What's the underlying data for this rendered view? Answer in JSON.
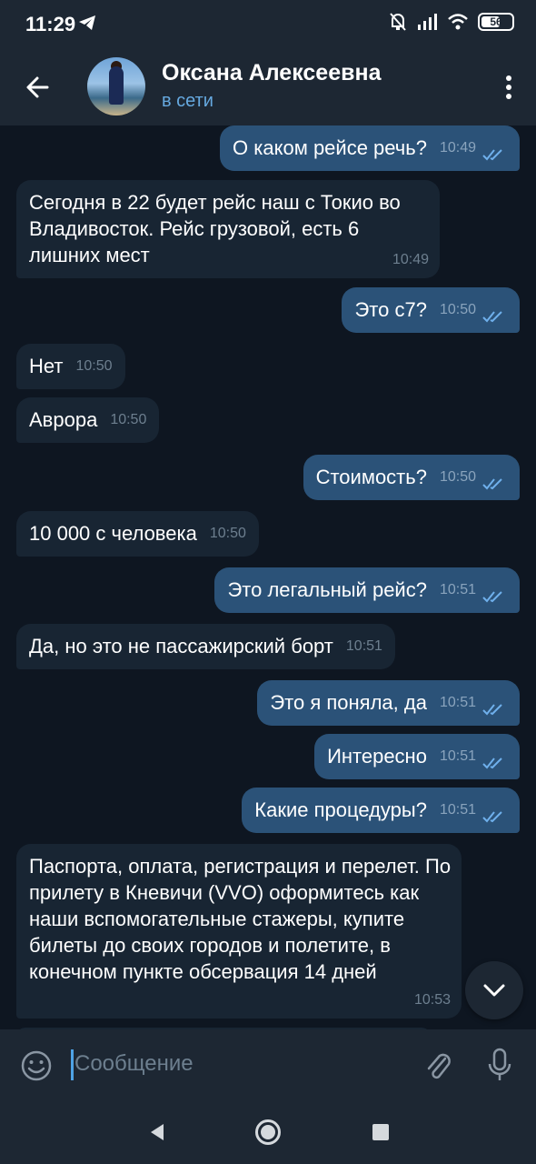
{
  "status_bar": {
    "time": "11:29",
    "battery": "56"
  },
  "header": {
    "contact_name": "Оксана Алексеевна",
    "status": "в сети"
  },
  "messages": [
    {
      "dir": "out",
      "text": "О каком рейсе речь?",
      "time": "10:49"
    },
    {
      "dir": "in",
      "text": "Сегодня в 22 будет рейс наш с Токио во Владивосток. Рейс грузовой, есть 6 лишних мест",
      "time": "10:49"
    },
    {
      "dir": "out",
      "text": "Это с7?",
      "time": "10:50"
    },
    {
      "dir": "in",
      "text": "Нет",
      "time": "10:50"
    },
    {
      "dir": "in",
      "text": "Аврора",
      "time": "10:50"
    },
    {
      "dir": "out",
      "text": "Стоимость?",
      "time": "10:50"
    },
    {
      "dir": "in",
      "text": "10 000 с человека",
      "time": "10:50"
    },
    {
      "dir": "out",
      "text": "Это легальный рейс?",
      "time": "10:51"
    },
    {
      "dir": "in",
      "text": "Да, но это не пассажирский борт",
      "time": "10:51"
    },
    {
      "dir": "out",
      "text": "Это я поняла, да",
      "time": "10:51"
    },
    {
      "dir": "out",
      "text": "Интересно",
      "time": "10:51"
    },
    {
      "dir": "out",
      "text": "Какие процедуры?",
      "time": "10:51"
    },
    {
      "dir": "in",
      "text": "Паспорта, оплата, регистрация и перелет. По прилету в Кневичи (VVO) оформитесь как наши вспомогательные стажеры, купите билеты до своих городов и полетите, в конечном пункте обсервация 14 дней",
      "time": "10:53"
    }
  ],
  "input": {
    "placeholder": "Сообщение"
  },
  "colors": {
    "outgoing_bubble": "#2b5278",
    "incoming_bubble": "#182533",
    "background": "#0e1621",
    "accent": "#66a9e0"
  },
  "icons": [
    "back-arrow-icon",
    "more-vert-icon",
    "emoji-icon",
    "attach-icon",
    "mic-icon",
    "scroll-down-icon"
  ]
}
